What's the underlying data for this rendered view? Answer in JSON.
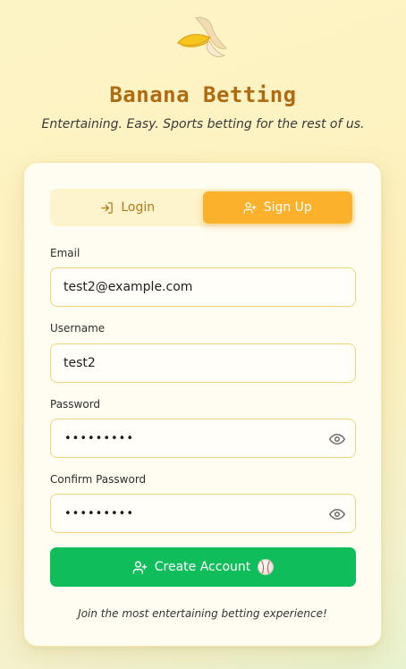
{
  "app": {
    "title": "Banana Betting",
    "tagline": "Entertaining. Easy. Sports betting for the rest of us.",
    "logo_icon": "banana-icon"
  },
  "tabs": [
    {
      "label": "Login",
      "icon": "login-icon",
      "active": false
    },
    {
      "label": "Sign Up",
      "icon": "user-plus-icon",
      "active": true
    }
  ],
  "form": {
    "email": {
      "label": "Email",
      "value": "test2@example.com"
    },
    "username": {
      "label": "Username",
      "value": "test2"
    },
    "password": {
      "label": "Password",
      "masked_value": "•••••••••",
      "toggle_icon": "eye-icon"
    },
    "confirm_password": {
      "label": "Confirm Password",
      "masked_value": "•••••••••",
      "toggle_icon": "eye-icon"
    },
    "submit_label": "Create Account",
    "submit_icons": [
      "user-plus-icon",
      "baseball-icon"
    ]
  },
  "footer_note": "Join the most entertaining betting experience!",
  "colors": {
    "accent": "#fbb12b",
    "title": "#b06a10",
    "submit": "#0fbd5b",
    "input_border": "#f1d675"
  }
}
